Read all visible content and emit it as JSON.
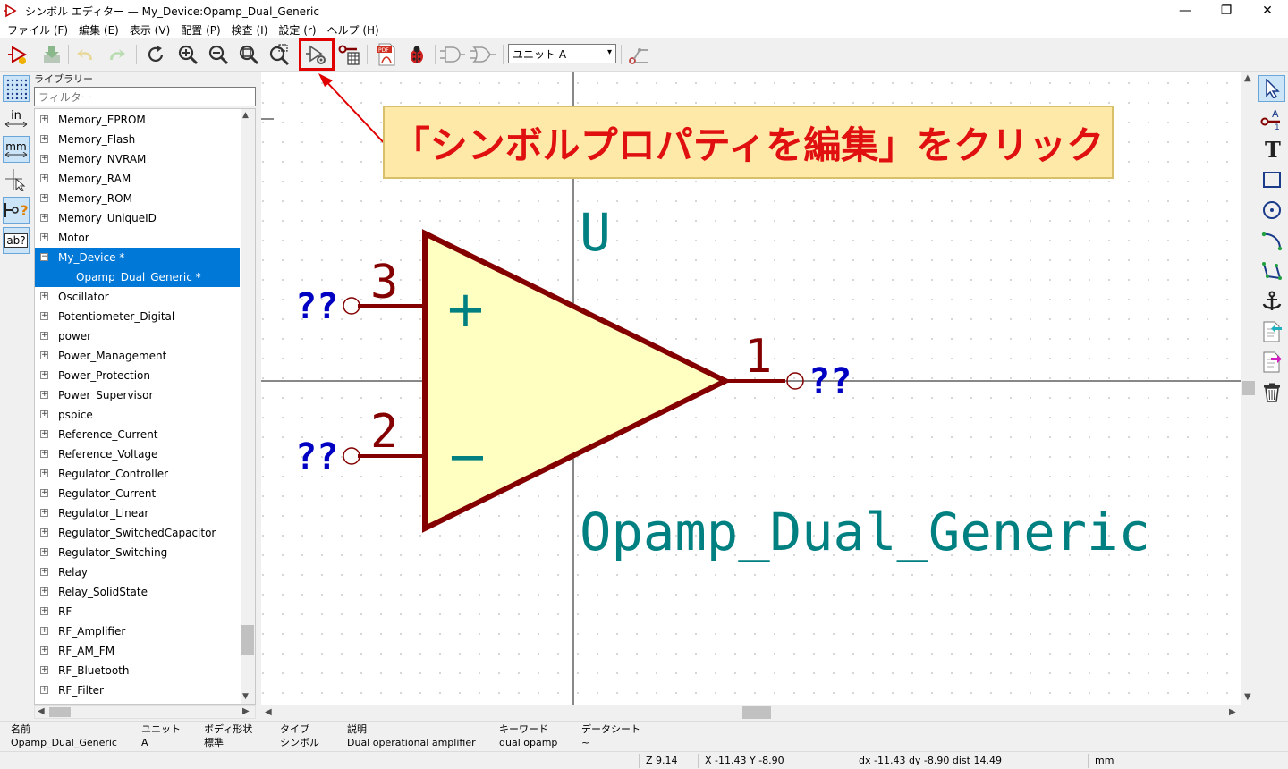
{
  "window": {
    "title": "シンボル エディター — My_Device:Opamp_Dual_Generic",
    "minimize": "—",
    "restore": "❐",
    "close": "✕"
  },
  "menu": [
    "ファイル (F)",
    "編集 (E)",
    "表示 (V)",
    "配置 (P)",
    "検査 (I)",
    "設定 (r)",
    "ヘルプ (H)"
  ],
  "toolbar": {
    "unit_select_value": "ユニット A",
    "tools": [
      "new-symbol-icon",
      "save-icon",
      "undo-icon",
      "redo-icon",
      "refresh-icon",
      "zoom-in-icon",
      "zoom-out-icon",
      "zoom-fit-icon",
      "zoom-selection-icon",
      "symbol-properties-icon",
      "pin-table-icon",
      "pdf-export-icon",
      "bug-check-icon",
      "de-morgan-standard-icon",
      "de-morgan-alternate-icon",
      "pin-connection-icon"
    ]
  },
  "left_tools": {
    "inch_label": "in",
    "mm_label": "mm",
    "pin_question": "?",
    "text_label": "ab?"
  },
  "library": {
    "caption": "ライブラリー",
    "filter_placeholder": "フィルター",
    "items": [
      {
        "label": "Memory_EPROM",
        "exp": "+"
      },
      {
        "label": "Memory_Flash",
        "exp": "+"
      },
      {
        "label": "Memory_NVRAM",
        "exp": "+"
      },
      {
        "label": "Memory_RAM",
        "exp": "+"
      },
      {
        "label": "Memory_ROM",
        "exp": "+"
      },
      {
        "label": "Memory_UniqueID",
        "exp": "+"
      },
      {
        "label": "Motor",
        "exp": "+"
      },
      {
        "label": "My_Device *",
        "exp": "−",
        "selected": true
      },
      {
        "label": "Opamp_Dual_Generic *",
        "exp": "",
        "selected": true,
        "child": true
      },
      {
        "label": "Oscillator",
        "exp": "+"
      },
      {
        "label": "Potentiometer_Digital",
        "exp": "+"
      },
      {
        "label": "power",
        "exp": "+"
      },
      {
        "label": "Power_Management",
        "exp": "+"
      },
      {
        "label": "Power_Protection",
        "exp": "+"
      },
      {
        "label": "Power_Supervisor",
        "exp": "+"
      },
      {
        "label": "pspice",
        "exp": "+"
      },
      {
        "label": "Reference_Current",
        "exp": "+"
      },
      {
        "label": "Reference_Voltage",
        "exp": "+"
      },
      {
        "label": "Regulator_Controller",
        "exp": "+"
      },
      {
        "label": "Regulator_Current",
        "exp": "+"
      },
      {
        "label": "Regulator_Linear",
        "exp": "+"
      },
      {
        "label": "Regulator_SwitchedCapacitor",
        "exp": "+"
      },
      {
        "label": "Regulator_Switching",
        "exp": "+"
      },
      {
        "label": "Relay",
        "exp": "+"
      },
      {
        "label": "Relay_SolidState",
        "exp": "+"
      },
      {
        "label": "RF",
        "exp": "+"
      },
      {
        "label": "RF_Amplifier",
        "exp": "+"
      },
      {
        "label": "RF_AM_FM",
        "exp": "+"
      },
      {
        "label": "RF_Bluetooth",
        "exp": "+"
      },
      {
        "label": "RF_Filter",
        "exp": "+"
      }
    ]
  },
  "symbol": {
    "reference": "U",
    "value": "Opamp_Dual_Generic",
    "pin_plus_number": "3",
    "pin_minus_number": "2",
    "pin_out_number": "1",
    "pin_name_unknown": "??",
    "plus_sign": "+",
    "minus_sign": "−",
    "body_fill": "#ffffc2",
    "body_stroke": "#840000",
    "field_color": "#008080",
    "pin_name_color": "#0000c2"
  },
  "callout": {
    "text": "「シンボルプロパティを編集」をクリック"
  },
  "info": {
    "name_label": "名前",
    "name_value": "Opamp_Dual_Generic",
    "unit_label": "ユニット",
    "unit_value": "A",
    "body_label": "ボディ形状",
    "body_value": "標準",
    "type_label": "タイプ",
    "type_value": "シンボル",
    "desc_label": "説明",
    "desc_value": "Dual operational amplifier",
    "keywords_label": "キーワード",
    "keywords_value": "dual opamp",
    "datasheet_label": "データシート",
    "datasheet_value": "~"
  },
  "status": {
    "zoom": "Z 9.14",
    "coords": "X -11.43  Y -8.90",
    "delta": "dx -11.43  dy -8.90  dist 14.49",
    "units": "mm"
  }
}
